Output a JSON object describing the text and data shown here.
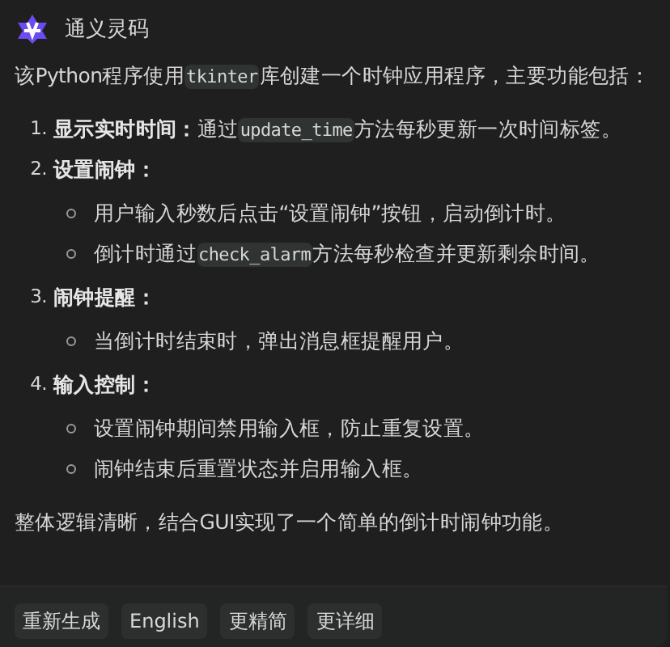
{
  "header": {
    "title": "通义灵码"
  },
  "intro": [
    {
      "kind": "text",
      "text": "该Python程序使用"
    },
    {
      "kind": "code",
      "text": "tkinter"
    },
    {
      "kind": "text",
      "text": "库创建一个时钟应用程序，主要功能包括："
    }
  ],
  "items": [
    {
      "number": "1.",
      "label": "显示实时时间：",
      "parts": [
        {
          "kind": "text",
          "text": "通过"
        },
        {
          "kind": "code",
          "text": "update_time"
        },
        {
          "kind": "text",
          "text": "方法每秒更新一次时间标签。"
        }
      ]
    },
    {
      "number": "2.",
      "label": "设置闹钟：",
      "children": [
        {
          "parts": [
            {
              "kind": "text",
              "text": "用户输入秒数后点击“设置闹钟”按钮，启动倒计时。"
            }
          ]
        },
        {
          "parts": [
            {
              "kind": "text",
              "text": "倒计时通过"
            },
            {
              "kind": "code",
              "text": "check_alarm"
            },
            {
              "kind": "text",
              "text": "方法每秒检查并更新剩余时间。"
            }
          ]
        }
      ]
    },
    {
      "number": "3.",
      "label": "闹钟提醒：",
      "children": [
        {
          "parts": [
            {
              "kind": "text",
              "text": "当倒计时结束时，弹出消息框提醒用户。"
            }
          ]
        }
      ]
    },
    {
      "number": "4.",
      "label": "输入控制：",
      "children": [
        {
          "parts": [
            {
              "kind": "text",
              "text": "设置闹钟期间禁用输入框，防止重复设置。"
            }
          ]
        },
        {
          "parts": [
            {
              "kind": "text",
              "text": "闹钟结束后重置状态并启用输入框。"
            }
          ]
        }
      ]
    }
  ],
  "summary": "整体逻辑清晰，结合GUI实现了一个简单的倒计时闹钟功能。",
  "actions": [
    "重新生成",
    "English",
    "更精简",
    "更详细"
  ]
}
